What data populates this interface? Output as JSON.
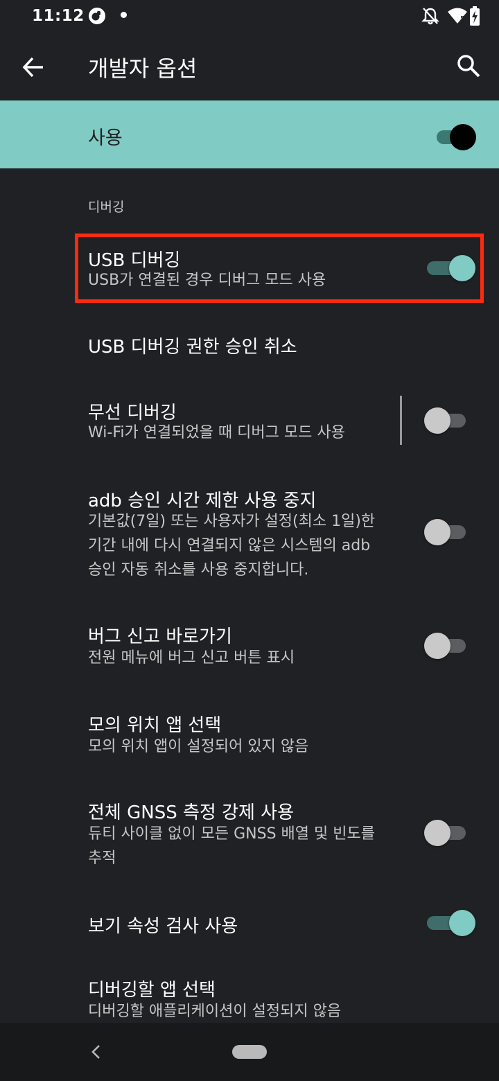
{
  "status_bar": {
    "time": "11:12",
    "icons": [
      "app-notification-icon",
      "dot-icon",
      "bell-off-icon",
      "wifi-icon",
      "battery-charging-icon"
    ]
  },
  "toolbar": {
    "title": "개발자 옵션",
    "back_icon": "arrow-back-icon",
    "search_icon": "search-icon"
  },
  "master_switch": {
    "label": "사용",
    "checked": true
  },
  "category": {
    "title": "디버깅"
  },
  "items": [
    {
      "title": "USB 디버깅",
      "summary": "USB가 연결된 경우 디버그 모드 사용",
      "switch": "on",
      "highlighted": true
    },
    {
      "title": "USB 디버깅 권한 승인 취소",
      "summary": ""
    },
    {
      "title": "무선 디버깅",
      "summary": "Wi-Fi가 연결되었을 때 디버그 모드 사용",
      "switch": "off"
    },
    {
      "title": "adb 승인 시간 제한 사용 중지",
      "summary": "기본값(7일) 또는 사용자가 설정(최소 1일)한\n기간 내에 다시 연결되지 않은 시스템의 adb\n승인 자동 취소를 사용 중지합니다.",
      "switch": "off"
    },
    {
      "title": "버그 신고 바로가기",
      "summary": "전원 메뉴에 버그 신고 버튼 표시",
      "switch": "off"
    },
    {
      "title": "모의 위치 앱 선택",
      "summary": "모의 위치 앱이 설정되어 있지 않음"
    },
    {
      "title": "전체 GNSS 측정 강제 사용",
      "summary": "듀티 사이클 없이 모든 GNSS 배열 및 빈도를\n추적",
      "switch": "off"
    },
    {
      "title": "보기 속성 검사 사용",
      "summary": "",
      "switch": "on"
    },
    {
      "title": "디버깅할 앱 선택",
      "summary": "디버깅할 애플리케이션이 설정되지 않음"
    }
  ],
  "colors": {
    "background": "#202124",
    "accent": "#80cbc4",
    "highlight": "#ff2a0d"
  },
  "nav_bar": {
    "icons": [
      "nav-back-icon",
      "home-pill-icon"
    ]
  }
}
